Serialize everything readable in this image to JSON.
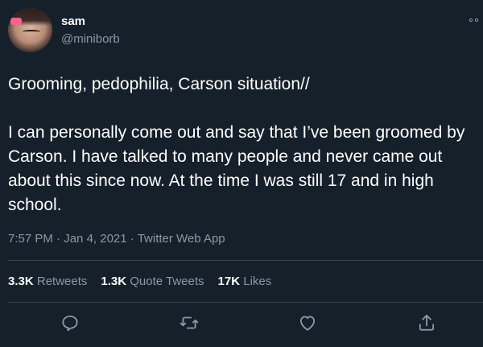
{
  "user": {
    "name": "sam",
    "handle": "@miniborb"
  },
  "tweet": {
    "text": "Grooming, pedophilia, Carson situation//\n\nI can personally come out and say that I’ve been groomed by Carson. I have talked to many people and never came out about this since now. At the time I was still 17 and in high school.",
    "time": "7:57 PM",
    "date": "Jan 4, 2021",
    "source": "Twitter Web App",
    "separator": " · "
  },
  "stats": {
    "retweets_count": "3.3K",
    "retweets_label": " Retweets",
    "quotes_count": "1.3K",
    "quotes_label": " Quote Tweets",
    "likes_count": "17K",
    "likes_label": " Likes"
  },
  "icons": {
    "more": "more-icon",
    "reply": "reply-icon",
    "retweet": "retweet-icon",
    "like": "heart-icon",
    "share": "share-icon"
  },
  "colors": {
    "background": "#15202b",
    "text": "#ffffff",
    "secondary": "#8899a6",
    "divider": "#38444d"
  }
}
